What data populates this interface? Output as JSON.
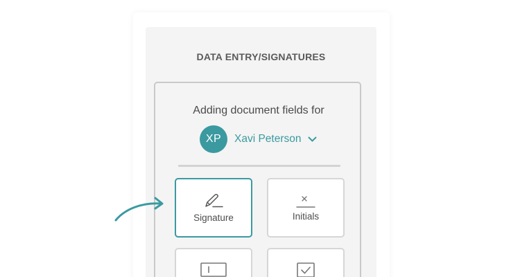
{
  "panel": {
    "title": "DATA ENTRY/SIGNATURES"
  },
  "fields": {
    "adding_label": "Adding document fields for",
    "signer": {
      "initials": "XP",
      "name": "Xavi Peterson",
      "avatar_color": "#3a9aa0"
    },
    "tiles": [
      {
        "label": "Signature",
        "icon": "pen-signature-icon",
        "selected": true
      },
      {
        "label": "Initials",
        "icon": "initials-icon",
        "selected": false
      },
      {
        "label": "",
        "icon": "text-field-icon",
        "selected": false
      },
      {
        "label": "",
        "icon": "checkbox-icon",
        "selected": false
      }
    ]
  },
  "colors": {
    "accent": "#3a9aa0",
    "panel_bg": "#f4f4f4",
    "border": "#c9c9c9"
  }
}
